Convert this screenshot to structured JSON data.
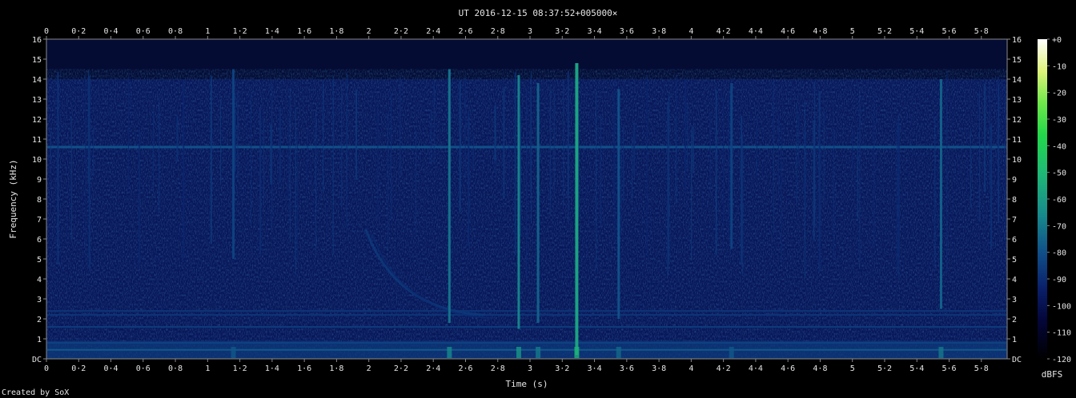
{
  "chart_data": {
    "type": "heatmap",
    "title": "UT 2016-12-15 08:37:52+005000×",
    "xlabel": "Time (s)",
    "ylabel": "Frequency (kHz)",
    "xlim": [
      0,
      5.96
    ],
    "ylim": [
      0,
      16
    ],
    "x_ticks": [
      "0",
      "0·2",
      "0·4",
      "0·6",
      "0·8",
      "1",
      "1·2",
      "1·4",
      "1·6",
      "1·8",
      "2",
      "2·2",
      "2·4",
      "2·6",
      "2·8",
      "3",
      "3·2",
      "3·4",
      "3·6",
      "3·8",
      "4",
      "4·2",
      "4·4",
      "4·6",
      "4·8",
      "5",
      "5·2",
      "5·4",
      "5·6",
      "5·8"
    ],
    "x_tick_values": [
      0,
      0.2,
      0.4,
      0.6,
      0.8,
      1.0,
      1.2,
      1.4,
      1.6,
      1.8,
      2.0,
      2.2,
      2.4,
      2.6,
      2.8,
      3.0,
      3.2,
      3.4,
      3.6,
      3.8,
      4.0,
      4.2,
      4.4,
      4.6,
      4.8,
      5.0,
      5.2,
      5.4,
      5.6,
      5.8
    ],
    "y_ticks": [
      "DC",
      "1",
      "2",
      "3",
      "4",
      "5",
      "6",
      "7",
      "8",
      "9",
      "10",
      "11",
      "12",
      "13",
      "14",
      "15",
      "16"
    ],
    "y_tick_values": [
      0,
      1,
      2,
      3,
      4,
      5,
      6,
      7,
      8,
      9,
      10,
      11,
      12,
      13,
      14,
      15,
      16
    ],
    "colorbar": {
      "label": "dBFS",
      "ticks": [
        "+0",
        "-10",
        "-20",
        "-30",
        "-40",
        "-50",
        "-60",
        "-70",
        "-80",
        "-90",
        "-100",
        "-110",
        "-120"
      ],
      "tick_values": [
        0,
        -10,
        -20,
        -30,
        -40,
        -50,
        -60,
        -70,
        -80,
        -90,
        -100,
        -110,
        -120
      ],
      "range": [
        -120,
        0
      ]
    },
    "background_level_dbfs": -98,
    "features": {
      "horizontal_lines": [
        {
          "freq_khz": 10.6,
          "level_dbfs": -80
        },
        {
          "freq_khz": 2.4,
          "level_dbfs": -88
        },
        {
          "freq_khz": 2.2,
          "level_dbfs": -88
        },
        {
          "freq_khz": 1.6,
          "level_dbfs": -86
        },
        {
          "freq_khz": 0.8,
          "level_dbfs": -84
        },
        {
          "freq_khz": 0.45,
          "level_dbfs": -78
        }
      ],
      "strong_sferics": [
        {
          "time_s": 2.5,
          "fmin_khz": 1.8,
          "fmax_khz": 14.5,
          "level_dbfs": -72
        },
        {
          "time_s": 2.93,
          "fmin_khz": 1.5,
          "fmax_khz": 14.2,
          "level_dbfs": -68
        },
        {
          "time_s": 3.29,
          "fmin_khz": 0.2,
          "fmax_khz": 14.8,
          "level_dbfs": -58
        },
        {
          "time_s": 3.05,
          "fmin_khz": 1.8,
          "fmax_khz": 13.8,
          "level_dbfs": -76
        },
        {
          "time_s": 3.55,
          "fmin_khz": 2.0,
          "fmax_khz": 13.5,
          "level_dbfs": -80
        },
        {
          "time_s": 5.55,
          "fmin_khz": 2.5,
          "fmax_khz": 14.0,
          "level_dbfs": -76
        },
        {
          "time_s": 1.16,
          "fmin_khz": 5.0,
          "fmax_khz": 14.5,
          "level_dbfs": -84
        },
        {
          "time_s": 4.25,
          "fmin_khz": 5.5,
          "fmax_khz": 13.8,
          "level_dbfs": -84
        }
      ],
      "tweek": {
        "start_time_s": 1.98,
        "end_time_s": 2.72,
        "freq_start_khz": 6.5,
        "freq_end_khz": 2.2,
        "level_dbfs": -86
      }
    }
  },
  "footer": {
    "credit": "Created by SoX"
  }
}
